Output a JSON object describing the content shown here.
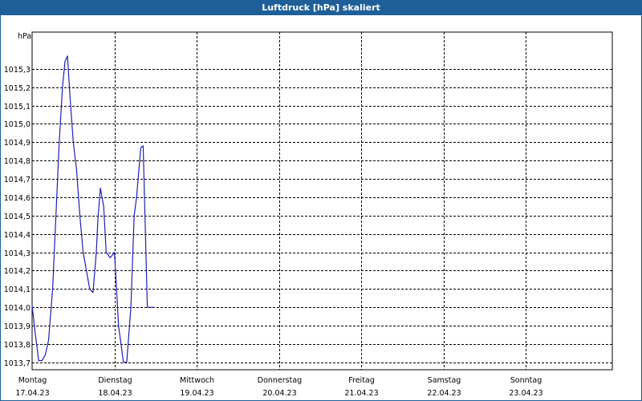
{
  "window": {
    "title": "Luftdruck [hPa] skaliert"
  },
  "chart_data": {
    "type": "line",
    "title": "Luftdruck [hPa] skaliert",
    "ylabel": "hPa",
    "ylim": [
      13.66,
      15.5
    ],
    "y_ticks": [
      {
        "value": 13.7,
        "label": "1013,7"
      },
      {
        "value": 13.8,
        "label": "1013,8"
      },
      {
        "value": 13.9,
        "label": "1013,9"
      },
      {
        "value": 14.0,
        "label": "1014,0"
      },
      {
        "value": 14.1,
        "label": "1014,1"
      },
      {
        "value": 14.2,
        "label": "1014,2"
      },
      {
        "value": 14.3,
        "label": "1014,3"
      },
      {
        "value": 14.4,
        "label": "1014,4"
      },
      {
        "value": 14.5,
        "label": "1014,5"
      },
      {
        "value": 14.6,
        "label": "1014,6"
      },
      {
        "value": 14.7,
        "label": "1014,7"
      },
      {
        "value": 14.8,
        "label": "1014,8"
      },
      {
        "value": 14.9,
        "label": "1014,9"
      },
      {
        "value": 15.0,
        "label": "1015,0"
      },
      {
        "value": 15.1,
        "label": "1015,1"
      },
      {
        "value": 15.2,
        "label": "1015,2"
      },
      {
        "value": 15.3,
        "label": "1015,3"
      }
    ],
    "x_ticks": [
      {
        "value": 0,
        "day": "Montag",
        "date": "17.04.23"
      },
      {
        "value": 1,
        "day": "Dienstag",
        "date": "18.04.23"
      },
      {
        "value": 2,
        "day": "Mittwoch",
        "date": "19.04.23"
      },
      {
        "value": 3,
        "day": "Donnerstag",
        "date": "20.04.23"
      },
      {
        "value": 4,
        "day": "Freitag",
        "date": "21.04.23"
      },
      {
        "value": 5,
        "day": "Samstag",
        "date": "22.04.23"
      },
      {
        "value": 6,
        "day": "Sonntag",
        "date": "23.04.23"
      }
    ],
    "xlim": [
      0,
      7.05
    ],
    "grid": true,
    "series": [
      {
        "color": "#1f1fb4",
        "x": [
          0.0,
          0.04,
          0.08,
          0.12,
          0.16,
          0.2,
          0.25,
          0.29,
          0.33,
          0.37,
          0.4,
          0.43,
          0.46,
          0.5,
          0.54,
          0.58,
          0.62,
          0.66,
          0.7,
          0.74,
          0.78,
          0.8,
          0.83,
          0.87,
          0.9,
          0.95,
          1.0,
          1.02,
          1.05,
          1.08,
          1.11,
          1.15,
          1.2,
          1.24,
          1.27,
          1.32,
          1.35,
          1.4,
          1.44,
          1.48
        ],
        "y": [
          14.01,
          13.85,
          13.71,
          13.71,
          13.74,
          13.82,
          14.1,
          14.5,
          14.9,
          15.2,
          15.34,
          15.37,
          15.15,
          14.9,
          14.75,
          14.5,
          14.3,
          14.2,
          14.1,
          14.08,
          14.3,
          14.48,
          14.65,
          14.55,
          14.3,
          14.27,
          14.3,
          14.15,
          13.9,
          13.8,
          13.7,
          13.7,
          14.0,
          14.5,
          14.6,
          14.87,
          14.88,
          14.0,
          14.0,
          14.0
        ]
      }
    ]
  }
}
